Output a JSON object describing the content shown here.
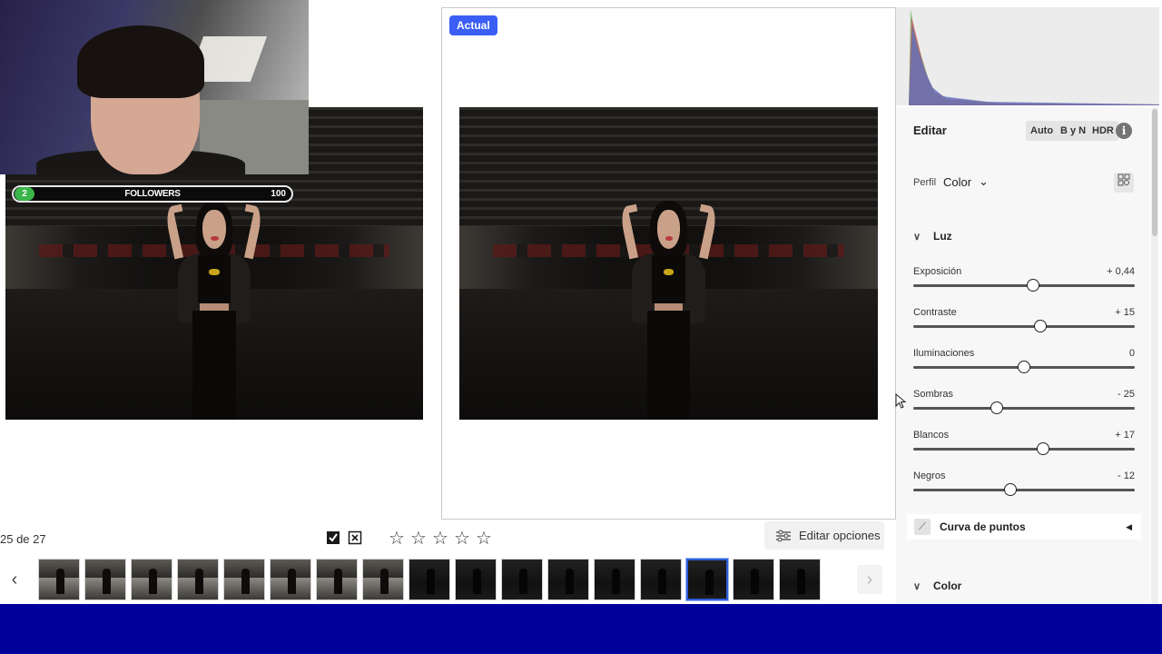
{
  "compare": {
    "badge": "Actual"
  },
  "webcam_overlay": {
    "followers_count": "2",
    "followers_label": "FOLLOWERS",
    "followers_goal": "100"
  },
  "toolbar": {
    "counter": "25 de 27",
    "flag_icons": [
      "flag-pick-icon",
      "flag-reject-icon"
    ],
    "stars": [
      "☆",
      "☆",
      "☆",
      "☆",
      "☆"
    ],
    "edit_options_label": "Editar opciones"
  },
  "filmstrip": {
    "prev": "‹",
    "next": "›",
    "selected_index": 14,
    "thumbnail_count": 17
  },
  "panel": {
    "title": "Editar",
    "buttons": [
      "Auto",
      "B y N",
      "HDR"
    ],
    "info": "i",
    "profile": {
      "label": "Perfil",
      "value": "Color",
      "chevron": "⌄"
    },
    "sections": {
      "light": "Luz",
      "color": "Color",
      "curve": "Curva de puntos"
    },
    "sliders": [
      {
        "label": "Exposición",
        "value": "+ 0,44",
        "position": 0.54
      },
      {
        "label": "Contraste",
        "value": "+ 15",
        "position": 0.575
      },
      {
        "label": "Iluminaciones",
        "value": "0",
        "position": 0.5
      },
      {
        "label": "Sombras",
        "value": "- 25",
        "position": 0.375
      },
      {
        "label": "Blancos",
        "value": "+ 17",
        "position": 0.585
      },
      {
        "label": "Negros",
        "value": "- 12",
        "position": 0.44
      }
    ]
  },
  "colors": {
    "accent": "#3b5ff5",
    "followers_green": "#3bb54a",
    "selected_border": "#2d5dd8",
    "bottom_band": "#00009a"
  }
}
